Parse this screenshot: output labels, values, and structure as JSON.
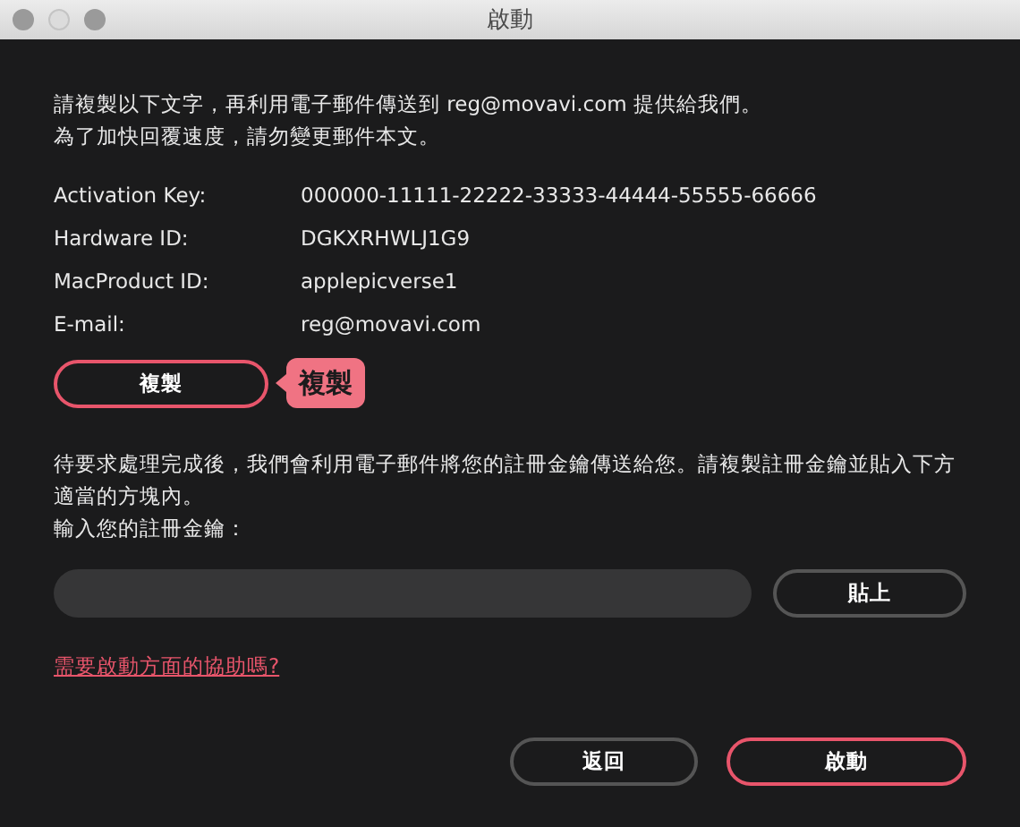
{
  "window": {
    "title": "啟動"
  },
  "intro": [
    "請複製以下文字，再利用電子郵件傳送到 reg@movavi.com 提供給我們。",
    "為了加快回覆速度，請勿變更郵件本文。"
  ],
  "info": [
    {
      "label": "Activation Key:",
      "value": "000000-11111-22222-33333-44444-55555-66666"
    },
    {
      "label": "Hardware ID:",
      "value": "DGKXRHWLJ1G9"
    },
    {
      "label": "MacProduct ID:",
      "value": "applepicverse1"
    },
    {
      "label": "E-mail:",
      "value": "reg@movavi.com"
    }
  ],
  "copy_button": {
    "label": "複製",
    "highlighted": true
  },
  "callout": "複製",
  "instructions": "待要求處理完成後，我們會利用電子郵件將您的註冊金鑰傳送給您。請複製註冊金鑰並貼入下方適當的方塊內。",
  "key_label": "輸入您的註冊金鑰：",
  "paste_button": {
    "label": "貼上",
    "highlighted": false
  },
  "help_link": "需要啟動方面的協助嗎?",
  "footer_buttons": [
    {
      "label": "返回",
      "highlighted": false
    },
    {
      "label": "啟動",
      "highlighted": true
    }
  ]
}
